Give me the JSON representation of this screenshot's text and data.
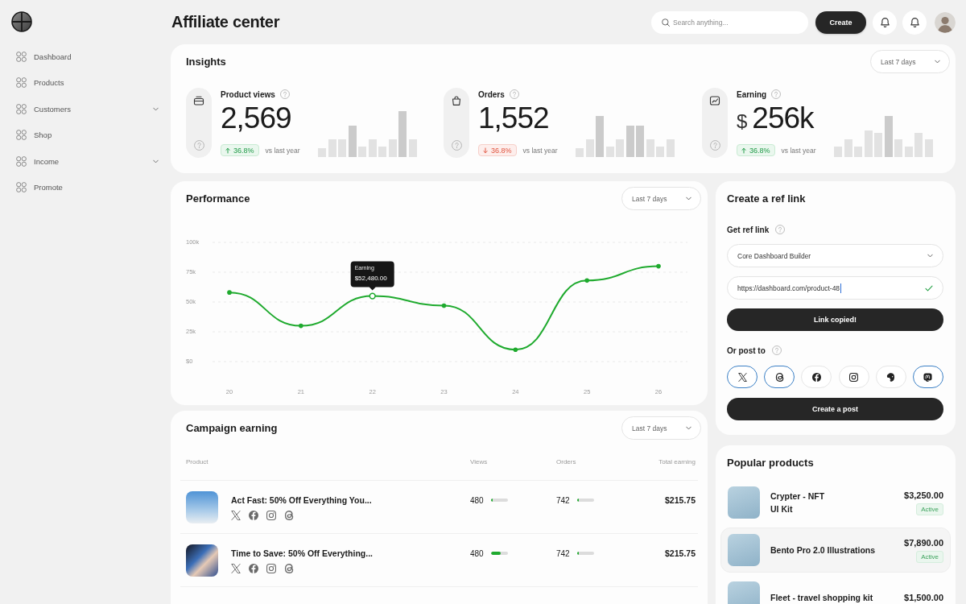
{
  "sidebar": {
    "items": [
      {
        "label": "Dashboard",
        "kind": "link"
      },
      {
        "label": "Products",
        "kind": "link"
      },
      {
        "label": "Customers",
        "kind": "menu"
      },
      {
        "label": "Shop",
        "kind": "link"
      },
      {
        "label": "Income",
        "kind": "menu"
      },
      {
        "label": "Promote",
        "kind": "link"
      }
    ]
  },
  "header": {
    "title": "Affiliate center",
    "search": {
      "placeholder": "Search anything..."
    },
    "create_button": "Create"
  },
  "insights": {
    "title": "Insights",
    "range": "Last 7 days",
    "metrics": [
      {
        "label": "Product views",
        "value": "2,569",
        "positive": true,
        "change": "36.8%",
        "comparison": "vs last year"
      },
      {
        "label": "Orders",
        "value": "1,552",
        "positive": false,
        "change": "36.8%",
        "comparison": "vs last year"
      },
      {
        "label": "Earning",
        "currency": "$",
        "value": "256k",
        "positive": true,
        "change": "36.8%",
        "comparison": "vs last year"
      }
    ]
  },
  "performance": {
    "title": "Performance",
    "range": "Last 7 days",
    "chart_data": {
      "type": "line",
      "categories": [
        "20",
        "21",
        "22",
        "23",
        "24",
        "25",
        "26"
      ],
      "series": [
        {
          "name": "Earning",
          "color": "#1faa2e",
          "values": [
            58000,
            30000,
            55000,
            47000,
            10000,
            68000,
            80000
          ]
        }
      ],
      "ylim": [
        0,
        100000
      ],
      "yticks": [
        {
          "value": 100000,
          "label": "100k"
        },
        {
          "value": 75000,
          "label": "75k"
        },
        {
          "value": 50000,
          "label": "50k"
        },
        {
          "value": 25000,
          "label": "25k"
        },
        {
          "value": 0,
          "label": "$0"
        }
      ],
      "grid": true,
      "annotations": [
        {
          "x": "22",
          "y": 55000,
          "text": "$52,480.00"
        }
      ]
    }
  },
  "ref_link": {
    "title": "Create a ref link",
    "get_label": "Get ref link",
    "product_select": {
      "value": "Core Dashboard Builder"
    },
    "link_field": {
      "value": "https://dashboard.com/product-48",
      "focused": true,
      "valid": true
    },
    "copy_button": "Link copied!",
    "post_label": "Or post to",
    "networks": [
      {
        "kind": "x",
        "selected": true
      },
      {
        "kind": "threads",
        "selected": true
      },
      {
        "kind": "facebook",
        "selected": false
      },
      {
        "kind": "instagram",
        "selected": false
      },
      {
        "kind": "elephant",
        "selected": false
      },
      {
        "kind": "mastodon",
        "selected": true
      }
    ],
    "post_button": "Create a post"
  },
  "campaign": {
    "title": "Campaign earning",
    "range": "Last 7 days",
    "columns": [
      "Product",
      "Views",
      "Orders",
      "Total earning"
    ],
    "rows": [
      {
        "product": "Act Fast: 50% Off Everything You...",
        "views": {
          "value": "480",
          "level": 0.12
        },
        "orders": {
          "value": "742",
          "level": 0.12
        },
        "total": "$215.75"
      },
      {
        "product": "Time to Save: 50% Off Everything...",
        "views": {
          "value": "480",
          "level": 0.57
        },
        "orders": {
          "value": "742",
          "level": 0.12
        },
        "total": "$215.75"
      }
    ]
  },
  "popular": {
    "title": "Popular products",
    "items": [
      {
        "name": "Crypter - NFT\nUI Kit",
        "price": "$3,250.00",
        "status": "Active",
        "selected": false
      },
      {
        "name": "Bento Pro 2.0 Illustrations",
        "price": "$7,890.00",
        "status": "Active",
        "selected": true
      },
      {
        "name": "Fleet - travel shopping kit",
        "price": "$1,500.00",
        "selected": false
      }
    ]
  }
}
